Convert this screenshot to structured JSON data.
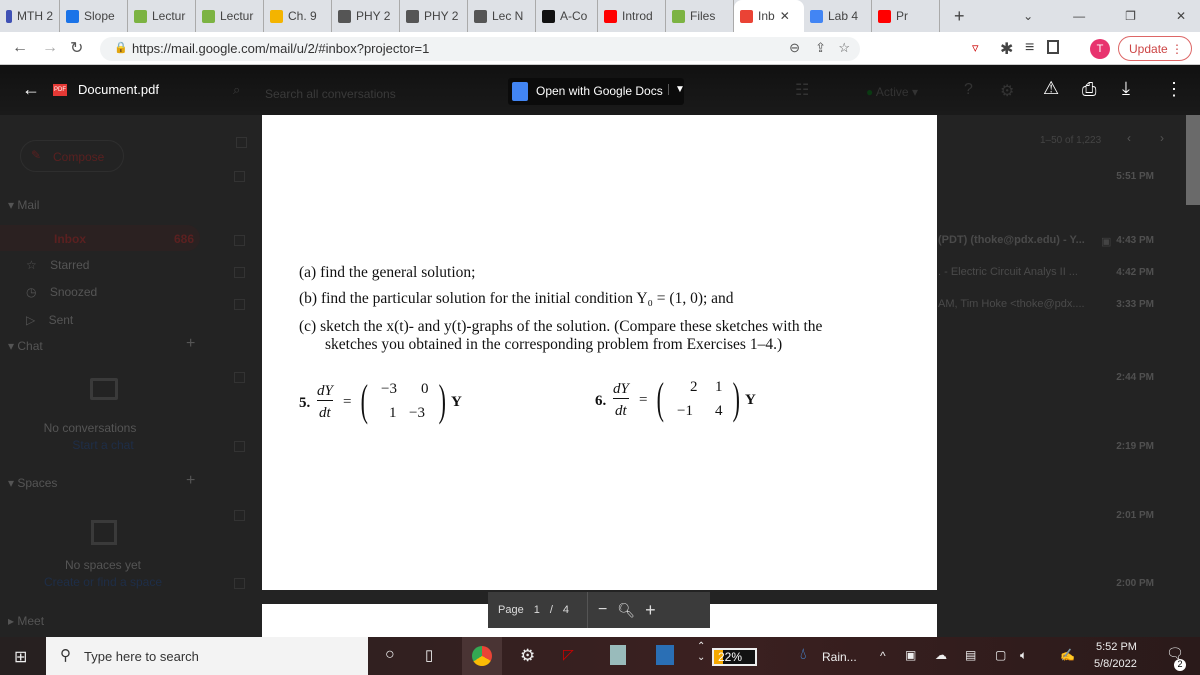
{
  "browser": {
    "tabs": [
      {
        "label": "MTH 2",
        "color": "#3f51b5"
      },
      {
        "label": "Slope",
        "color": "#1a73e8"
      },
      {
        "label": "Lectur",
        "color": "#7cb342"
      },
      {
        "label": "Lectur",
        "color": "#7cb342"
      },
      {
        "label": "Ch. 9",
        "color": "#f4b400"
      },
      {
        "label": "PHY 2",
        "color": "#555"
      },
      {
        "label": "PHY 2",
        "color": "#555"
      },
      {
        "label": "Lec N",
        "color": "#555"
      },
      {
        "label": "A-Co",
        "color": "#111"
      },
      {
        "label": "Introd",
        "color": "#ff0000"
      },
      {
        "label": "Files",
        "color": "#7cb342"
      },
      {
        "label": "Inb",
        "color": "#ea4335",
        "active": true
      },
      {
        "label": "Lab 4",
        "color": "#4285f4"
      },
      {
        "label": "Pr",
        "color": "#ff0000"
      }
    ],
    "url": "https://mail.google.com/mail/u/2/#inbox?projector=1",
    "profile_initial": "T",
    "update_label": "Update"
  },
  "viewer": {
    "filename": "Document.pdf",
    "open_with": "Open with Google Docs",
    "page_label": "Page",
    "page_current": "1",
    "page_sep": "/",
    "page_total": "4"
  },
  "gmail": {
    "search_placeholder": "Search all conversations",
    "status": "Active",
    "compose": "Compose",
    "mail_header": "Mail",
    "nav": [
      {
        "label": "Inbox",
        "count": "686"
      },
      {
        "label": "Starred"
      },
      {
        "label": "Snoozed"
      },
      {
        "label": "Sent"
      }
    ],
    "chat_header": "Chat",
    "no_conversations": "No conversations",
    "start_chat": "Start a chat",
    "spaces_header": "Spaces",
    "no_spaces": "No spaces yet",
    "create_space": "Create or find a space",
    "meet_header": "Meet",
    "pagination": "1–50 of 1,223",
    "rows": [
      {
        "snippet": "",
        "time": "5:51 PM"
      },
      {
        "snippet": "(PDT) (thoke@pdx.edu) - Y...",
        "time": "4:43 PM"
      },
      {
        "snippet": ". - Electric Circuit Analys II ...",
        "time": "4:42 PM"
      },
      {
        "snippet": "AM, Tim Hoke <thoke@pdx....",
        "time": "3:33 PM"
      },
      {
        "snippet": "",
        "time": "2:44 PM"
      },
      {
        "snippet": "",
        "time": "2:19 PM"
      },
      {
        "snippet": "",
        "time": "2:01 PM"
      },
      {
        "snippet": "",
        "time": "2:00 PM"
      }
    ]
  },
  "document": {
    "a": "(a) find the general solution;",
    "b": "(b) find the particular solution for the initial condition Y₀ = (1, 0); and",
    "c1": "(c) sketch the x(t)- and y(t)-graphs of the solution. (Compare these sketches with the",
    "c2": "sketches you obtained in the corresponding problem from Exercises 1–4.)",
    "p5": {
      "num": "5.",
      "m": [
        "−3",
        "0",
        "1",
        "−3"
      ]
    },
    "p6": {
      "num": "6.",
      "m": [
        "2",
        "1",
        "−1",
        "4"
      ]
    },
    "dY": "dY",
    "dt": "dt",
    "eq": "=",
    "Y": "Y"
  },
  "taskbar": {
    "search": "Type here to search",
    "battery": "22%",
    "weather": "Rain...",
    "time": "5:52 PM",
    "date": "5/8/2022",
    "notifications": "2"
  }
}
